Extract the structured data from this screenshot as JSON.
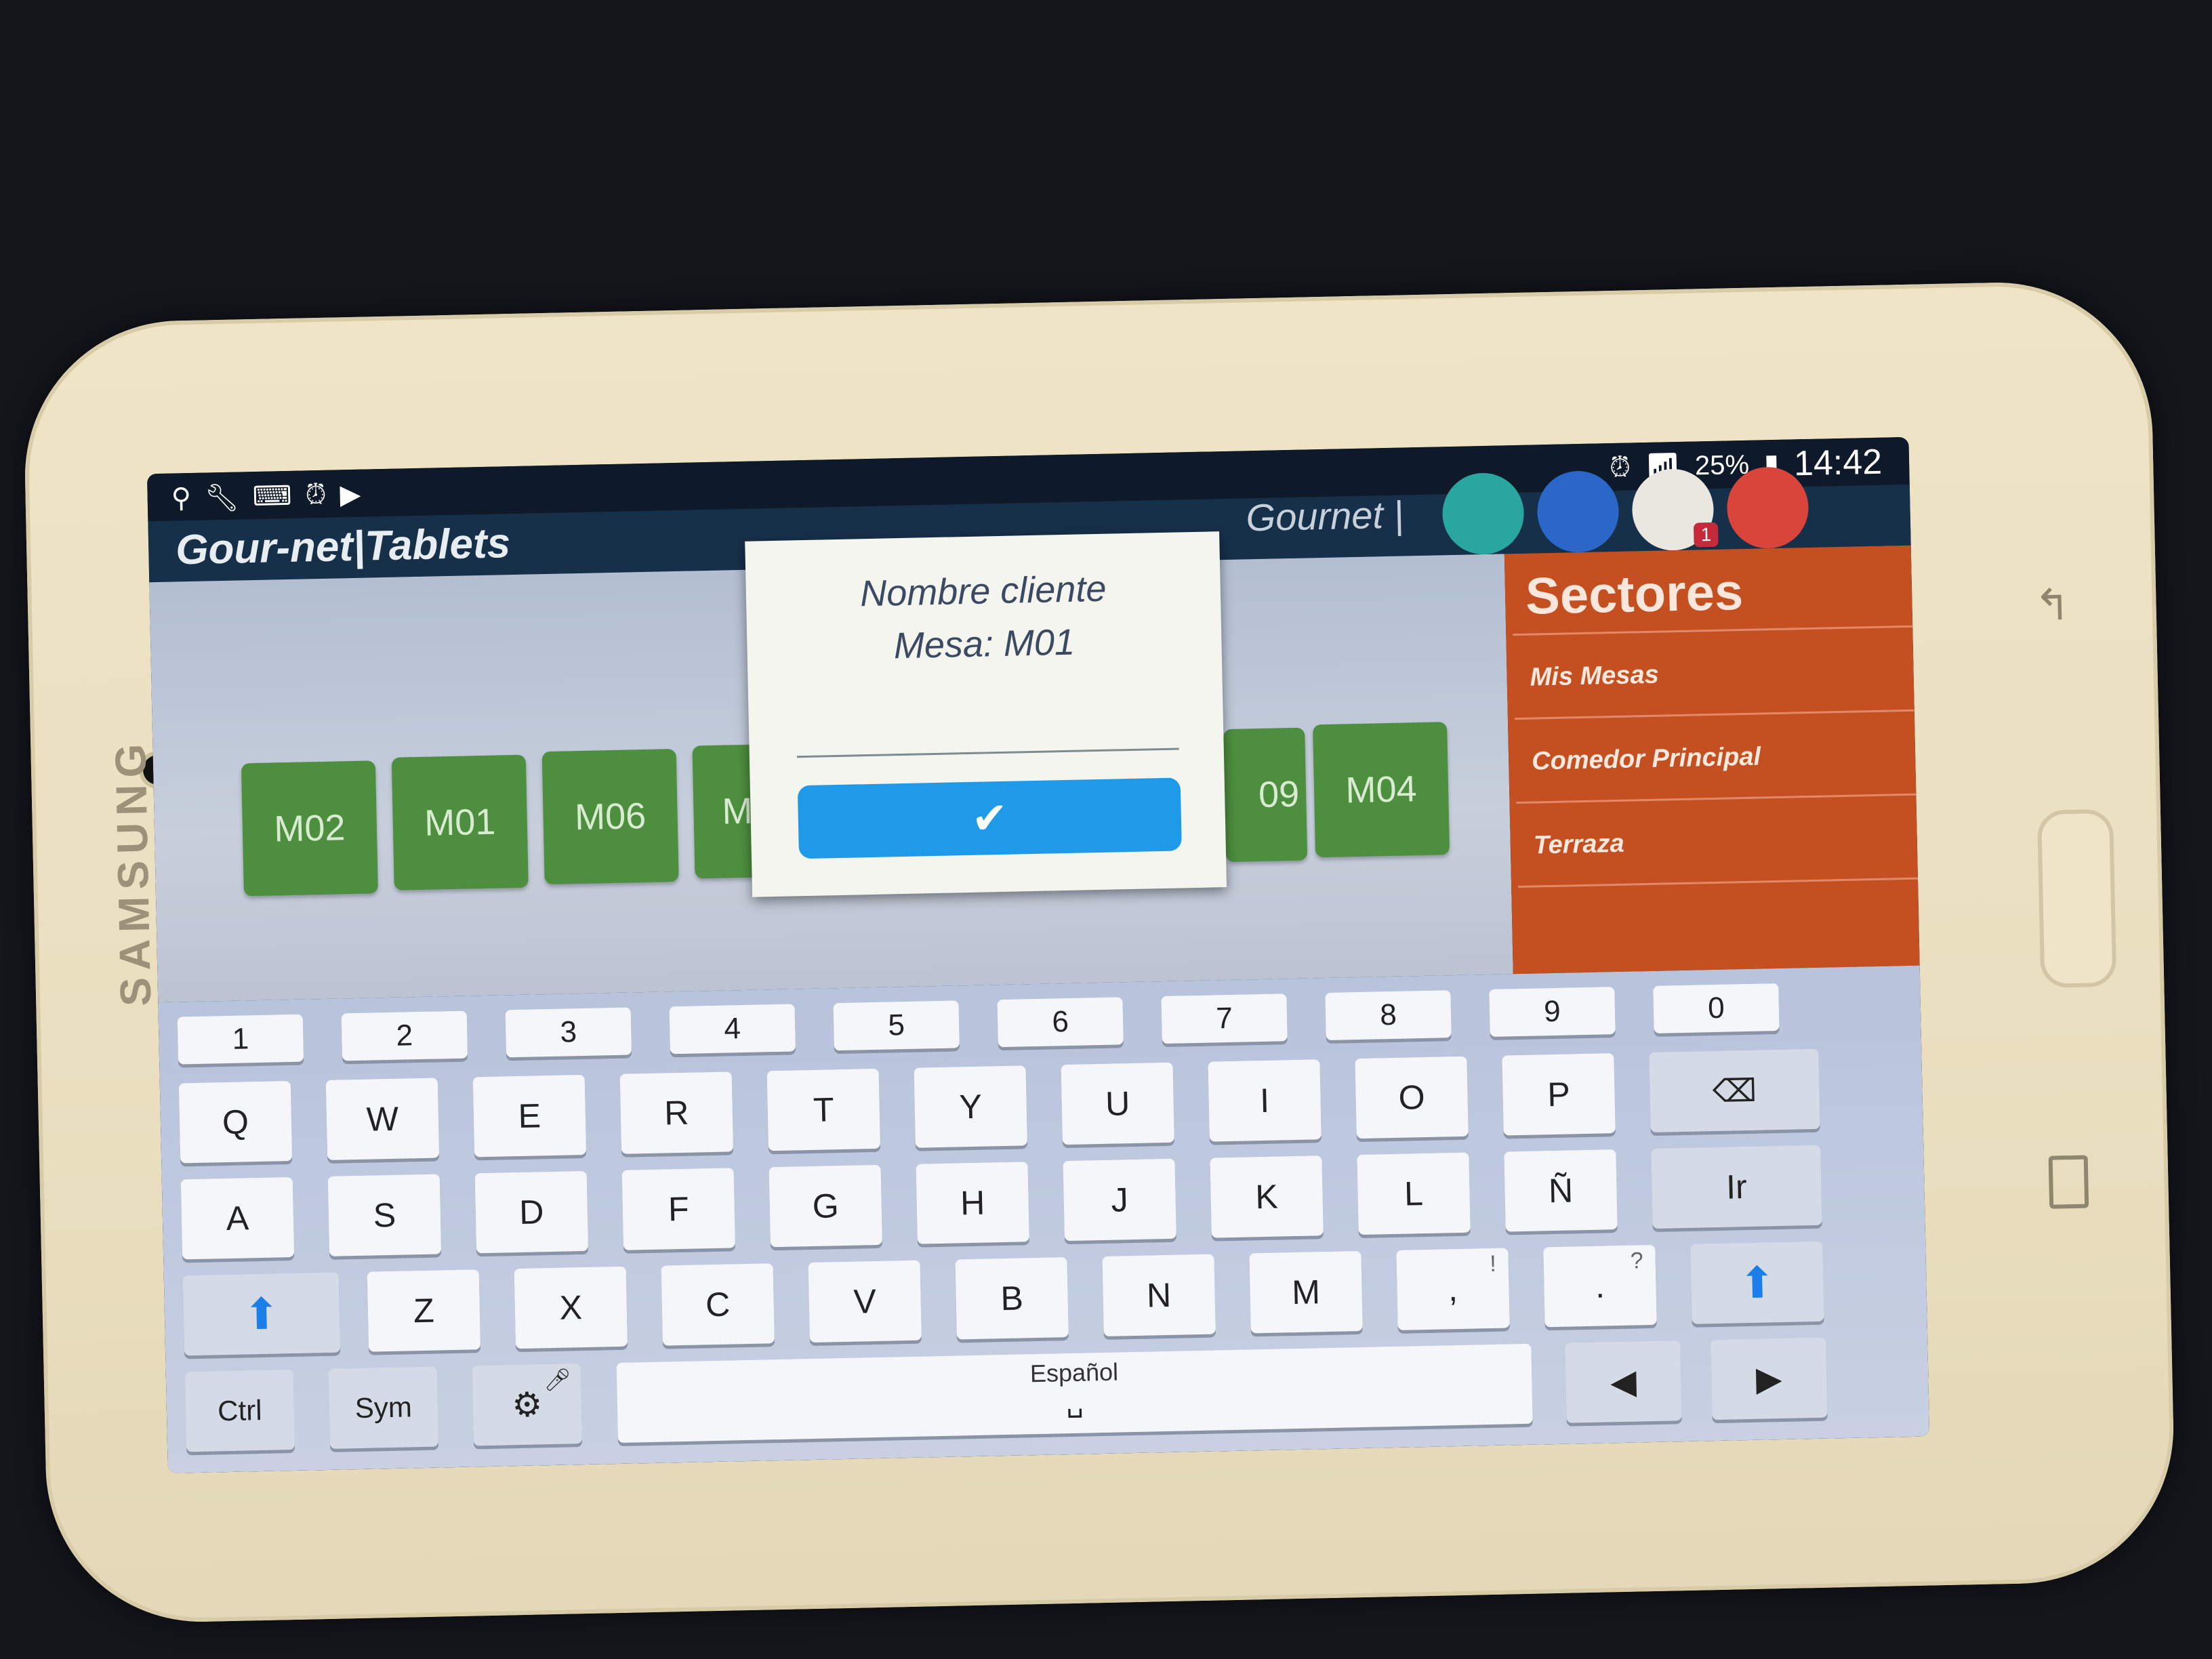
{
  "device": {
    "brand": "SAMSUNG"
  },
  "status_bar": {
    "battery": "25%",
    "time": "14:42"
  },
  "app": {
    "title": "Gour-net|Tablets",
    "header_right": "Gournet |",
    "notification_count": "1"
  },
  "tables": [
    "M02",
    "M01",
    "M06",
    "M",
    "09",
    "M04"
  ],
  "sidebar": {
    "title": "Sectores",
    "items": [
      {
        "label": "Mis Mesas"
      },
      {
        "label": "Comedor Principal"
      },
      {
        "label": "Terraza"
      }
    ]
  },
  "dialog": {
    "title": "Nombre cliente",
    "subtitle": "Mesa: M01",
    "input_value": "",
    "confirm_icon": "check-icon"
  },
  "keyboard": {
    "numbers": [
      "1",
      "2",
      "3",
      "4",
      "5",
      "6",
      "7",
      "8",
      "9",
      "0"
    ],
    "row1": [
      "Q",
      "W",
      "E",
      "R",
      "T",
      "Y",
      "U",
      "I",
      "O",
      "P"
    ],
    "row2": [
      "A",
      "S",
      "D",
      "F",
      "G",
      "H",
      "J",
      "K",
      "L",
      "Ñ"
    ],
    "enter_label": "Ir",
    "row3": [
      "Z",
      "X",
      "C",
      "V",
      "B",
      "N",
      "M"
    ],
    "punct1_main": ",",
    "punct1_sub": "!",
    "punct2_main": ".",
    "punct2_sub": "?",
    "ctrl_label": "Ctrl",
    "sym_label": "Sym",
    "space_label": "Español",
    "accent_color": "#1c7ee8"
  }
}
